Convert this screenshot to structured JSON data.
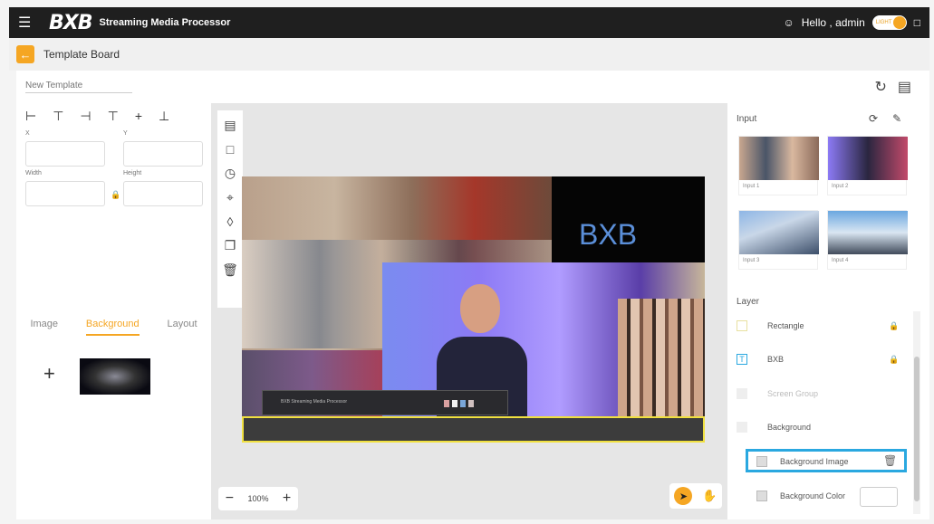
{
  "header": {
    "logo": "BXB",
    "app_name": "Streaming Media Processor",
    "greeting": "Hello , admin",
    "theme_toggle": "LIGHT",
    "menu_icon": "hamburger-icon",
    "user_icon": "user-icon",
    "expand_icon": "expand-icon"
  },
  "subheader": {
    "back_icon": "arrow-left-icon",
    "title": "Template Board"
  },
  "template": {
    "name_placeholder": "New Template",
    "refresh_icon": "refresh-icon",
    "save_icon": "save-icon"
  },
  "properties": {
    "x_label": "X",
    "y_label": "Y",
    "width_label": "Width",
    "height_label": "Height"
  },
  "left_tabs": [
    "Image",
    "Background",
    "Layout"
  ],
  "active_tab": "Background",
  "zoom": "100%",
  "canvas_text": "BXB",
  "device_label": "BXB   Streaming Media Processor",
  "input": {
    "title": "Input",
    "items": [
      "Input 1",
      "Input 2",
      "Input 3",
      "Input 4"
    ]
  },
  "layer": {
    "title": "Layer",
    "items": [
      {
        "label": "Rectangle",
        "icon": "rectangle-icon",
        "locked": true
      },
      {
        "label": "BXB",
        "icon": "text-icon",
        "locked": true
      },
      {
        "label": "Screen Group",
        "icon": "folder-icon",
        "locked": false
      },
      {
        "label": "Background",
        "icon": "folder-icon",
        "locked": false
      },
      {
        "label": "Background Image",
        "icon": "image-icon",
        "locked": false
      },
      {
        "label": "Background Color",
        "icon": "color-icon",
        "locked": false
      }
    ]
  },
  "colors": {
    "accent": "#f5a623",
    "selection": "#2aa8e0",
    "bxb_text": "#5b8fd9",
    "highlight_border": "#f0e040"
  }
}
